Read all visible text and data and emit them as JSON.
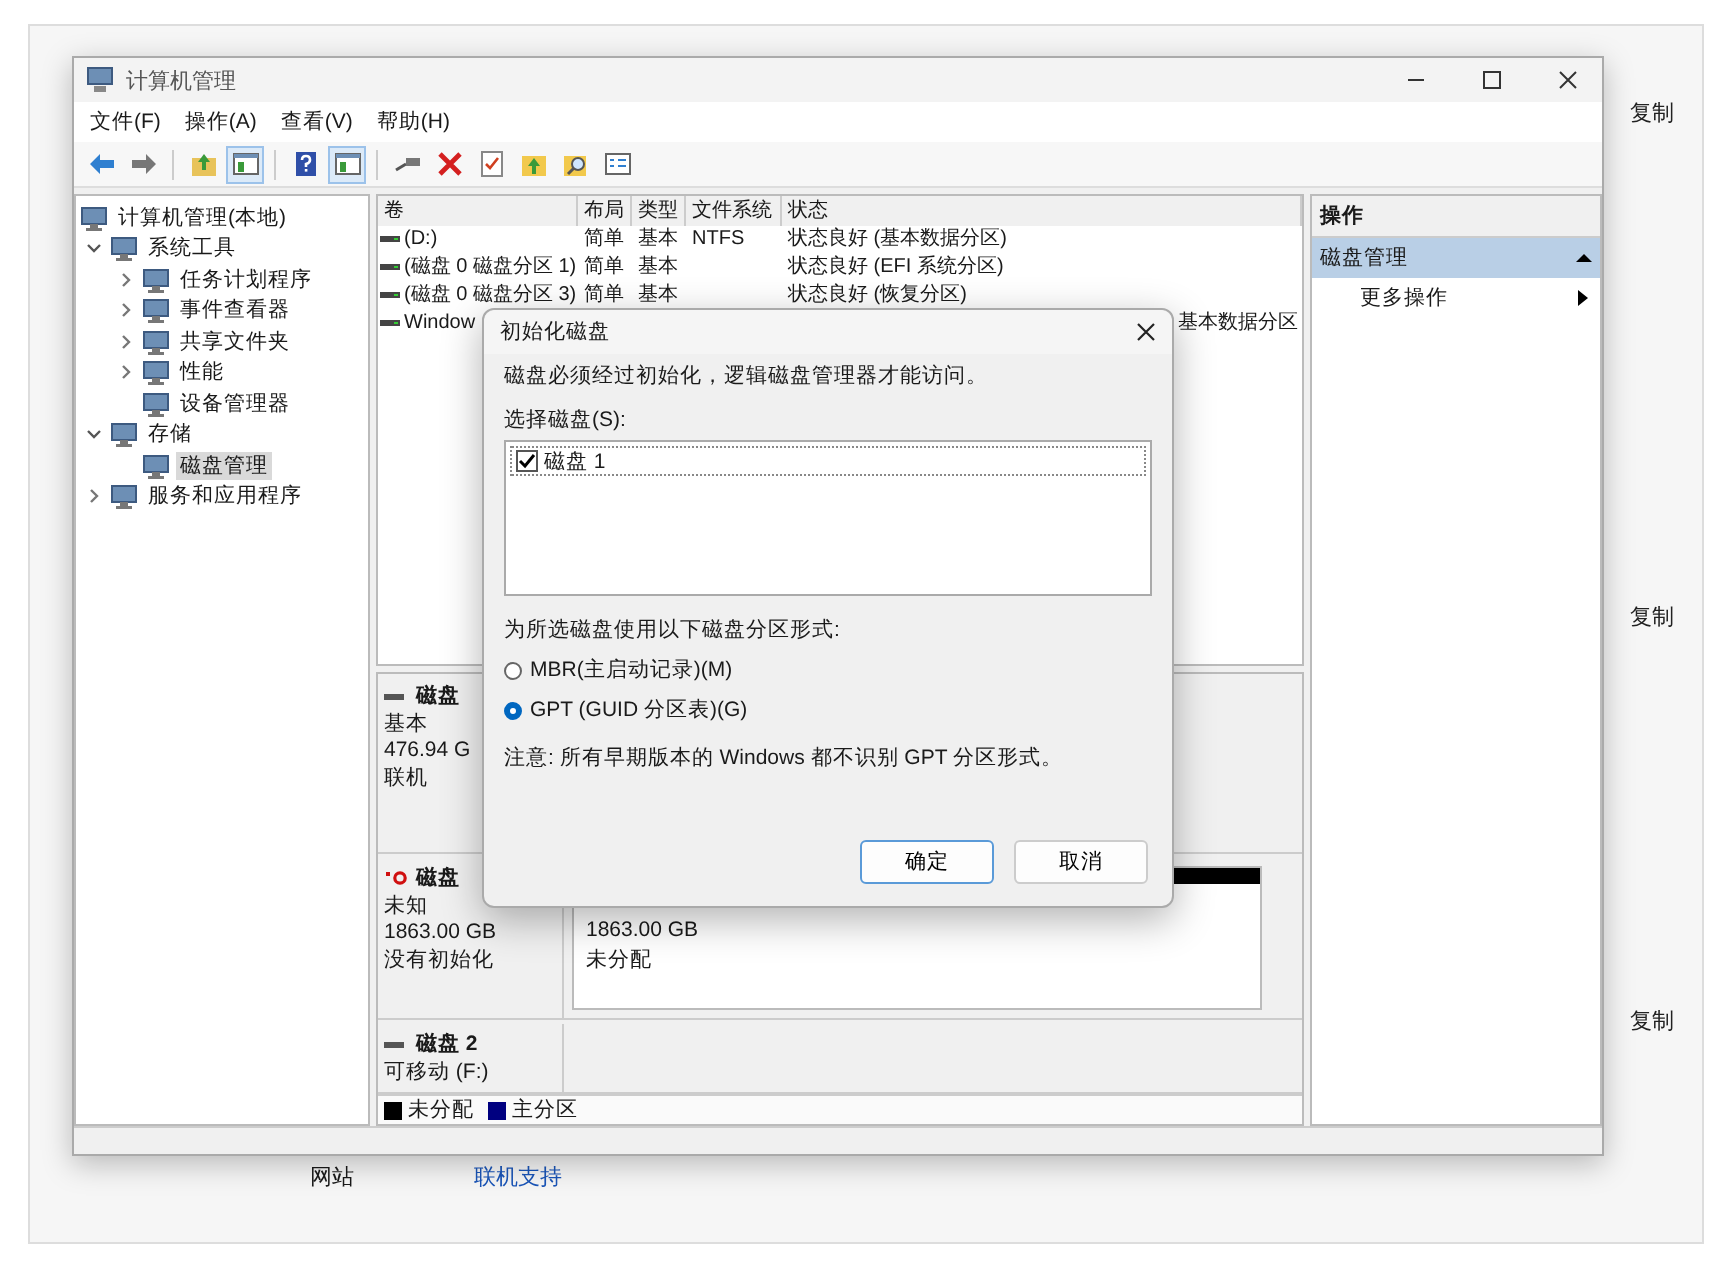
{
  "background": {
    "copy_buttons": [
      "复制",
      "复制",
      "复制"
    ],
    "footer": [
      {
        "label": "网站",
        "kind": "text"
      },
      {
        "label": "联机支持",
        "kind": "link"
      }
    ]
  },
  "window": {
    "title": "计算机管理"
  },
  "menu": [
    "文件(F)",
    "操作(A)",
    "查看(V)",
    "帮助(H)"
  ],
  "toolbar": [
    {
      "kind": "back"
    },
    {
      "kind": "forward"
    },
    {
      "kind": "sep"
    },
    {
      "kind": "up",
      "pressed": false
    },
    {
      "kind": "pane",
      "pressed": true
    },
    {
      "kind": "sep"
    },
    {
      "kind": "help",
      "pressed": false
    },
    {
      "kind": "pane",
      "pressed": true
    },
    {
      "kind": "sep"
    },
    {
      "kind": "connect"
    },
    {
      "kind": "delete"
    },
    {
      "kind": "check"
    },
    {
      "kind": "folder"
    },
    {
      "kind": "search"
    },
    {
      "kind": "list"
    }
  ],
  "tree": [
    {
      "label": "计算机管理(本地)",
      "selected": false,
      "children": [
        {
          "label": "系统工具",
          "selected": false,
          "expanded": true,
          "children": [
            {
              "label": "任务计划程序",
              "selected": false,
              "expanded": false
            },
            {
              "label": "事件查看器",
              "selected": false,
              "expanded": false
            },
            {
              "label": "共享文件夹",
              "selected": false,
              "expanded": false
            },
            {
              "label": "性能",
              "selected": false,
              "expanded": false
            },
            {
              "label": "设备管理器",
              "selected": false
            }
          ]
        },
        {
          "label": "存储",
          "selected": false,
          "expanded": true,
          "children": [
            {
              "label": "磁盘管理",
              "selected": true
            }
          ]
        },
        {
          "label": "服务和应用程序",
          "selected": false,
          "expanded": false
        }
      ]
    }
  ],
  "volumes": {
    "columns": [
      "卷",
      "布局",
      "类型",
      "文件系统",
      "状态"
    ],
    "rows": [
      {
        "volume": "(D:)",
        "layout": "简单",
        "type": "基本",
        "fs": "NTFS",
        "status": "状态良好 (基本数据分区)"
      },
      {
        "volume": "(磁盘 0 磁盘分区 1)",
        "layout": "简单",
        "type": "基本",
        "status": "状态良好 (EFI 系统分区)"
      },
      {
        "volume": "(磁盘 0 磁盘分区 3)",
        "layout": "简单",
        "type": "基本",
        "status": "状态良好 (恢复分区)"
      },
      {
        "volume": "Window",
        "status": "基本数据分区"
      }
    ]
  },
  "disks": [
    {
      "kind": "online",
      "name": "磁盘",
      "type": "基本",
      "size": "476.94 G",
      "status": "联机"
    },
    {
      "kind": "uninitialized",
      "name": "磁盘",
      "type": "未知",
      "size": "1863.00 GB",
      "status": "没有初始化",
      "partition": {
        "size": "1863.00 GB",
        "label": "未分配"
      }
    },
    {
      "kind": "removable",
      "name": "磁盘 2",
      "type": "可移动 (F:)"
    }
  ],
  "legend": [
    {
      "label": "未分配",
      "color": "#000000"
    },
    {
      "label": "主分区",
      "color": "#000080"
    }
  ],
  "actions": {
    "header": "操作",
    "section": {
      "label": "磁盘管理",
      "expanded": true
    },
    "items": [
      "更多操作"
    ]
  },
  "dialog": {
    "title": "初始化磁盘",
    "message": "磁盘必须经过初始化，逻辑磁盘管理器才能访问。",
    "select_label": "选择磁盘(S):",
    "disks": [
      {
        "label": "磁盘 1",
        "checked": true
      }
    ],
    "style_label": "为所选磁盘使用以下磁盘分区形式:",
    "styles": [
      {
        "label": "MBR(主启动记录)(M)",
        "selected": false
      },
      {
        "label": "GPT (GUID 分区表)(G)",
        "selected": true
      }
    ],
    "note": "注意: 所有早期版本的 Windows 都不识别 GPT 分区形式。",
    "buttons": [
      {
        "label": "确定",
        "kind": "default"
      },
      {
        "label": "取消",
        "kind": "normal"
      }
    ]
  }
}
